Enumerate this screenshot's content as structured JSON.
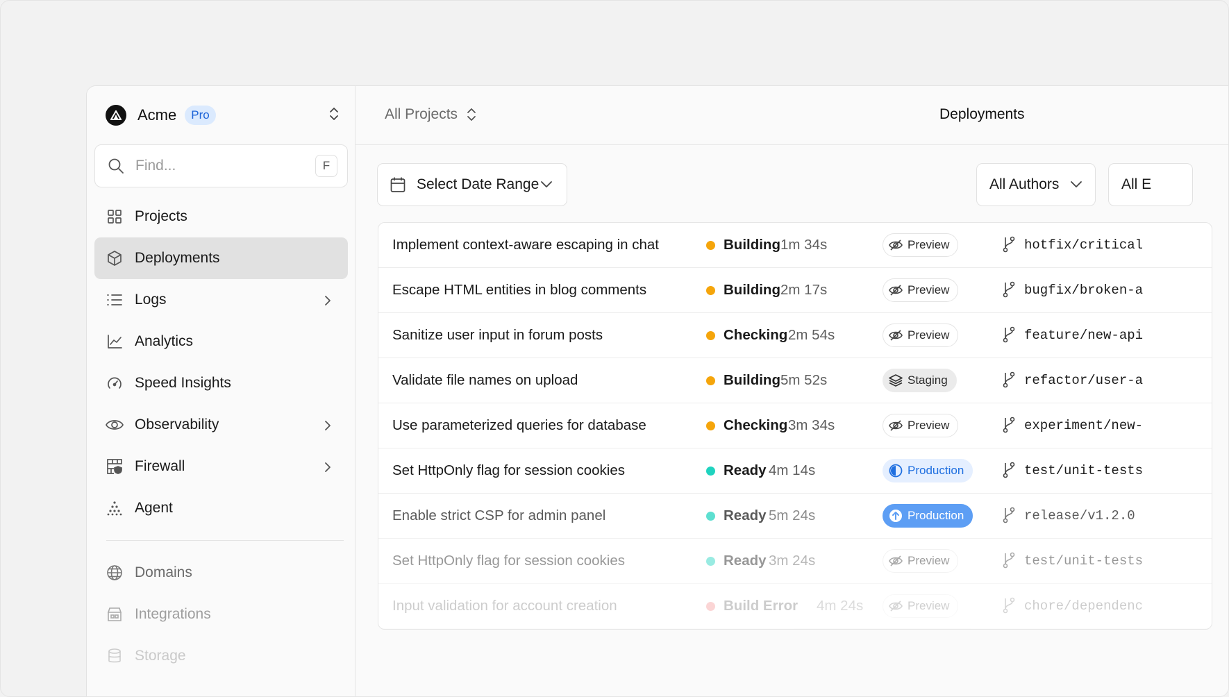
{
  "sidebar": {
    "team_name": "Acme",
    "plan_badge": "Pro",
    "search_placeholder": "Find...",
    "search_shortcut": "F",
    "items": [
      {
        "label": "Projects",
        "icon": "grid-icon"
      },
      {
        "label": "Deployments",
        "icon": "cube-icon",
        "active": true
      },
      {
        "label": "Logs",
        "icon": "list-icon",
        "has_chevron": true
      },
      {
        "label": "Analytics",
        "icon": "line-chart-icon"
      },
      {
        "label": "Speed Insights",
        "icon": "gauge-icon"
      },
      {
        "label": "Observability",
        "icon": "eye-icon",
        "has_chevron": true
      },
      {
        "label": "Firewall",
        "icon": "firewall-icon",
        "has_chevron": true
      },
      {
        "label": "Agent",
        "icon": "sparkle-dots-icon"
      }
    ],
    "secondary_items": [
      {
        "label": "Domains",
        "icon": "globe-icon"
      },
      {
        "label": "Integrations",
        "icon": "integrations-icon"
      },
      {
        "label": "Storage",
        "icon": "database-icon"
      }
    ]
  },
  "header": {
    "project_selector": "All Projects",
    "title": "Deployments"
  },
  "filters": {
    "date_range": "Select Date Range",
    "authors": "All Authors",
    "environments_partial": "All E"
  },
  "deployments": [
    {
      "message": "Implement context-aware escaping in chat",
      "status": "Building",
      "duration": "1m 34s",
      "environment": "Preview",
      "branch": "hotfix/critical",
      "status_color": "#f5a50b"
    },
    {
      "message": "Escape HTML entities in blog comments",
      "status": "Building",
      "duration": "2m 17s",
      "environment": "Preview",
      "branch": "bugfix/broken-a",
      "status_color": "#f5a50b"
    },
    {
      "message": "Sanitize user input in forum posts",
      "status": "Checking",
      "duration": "2m 54s",
      "environment": "Preview",
      "branch": "feature/new-api",
      "status_color": "#f5a50b"
    },
    {
      "message": "Validate file names on upload",
      "status": "Building",
      "duration": "5m 52s",
      "environment": "Staging",
      "branch": "refactor/user-a",
      "status_color": "#f5a50b"
    },
    {
      "message": "Use parameterized queries for database",
      "status": "Checking",
      "duration": "3m 34s",
      "environment": "Preview",
      "branch": "experiment/new-",
      "status_color": "#f5a50b"
    },
    {
      "message": "Set HttpOnly flag for session cookies",
      "status": "Ready",
      "duration": "4m 14s",
      "environment": "Production",
      "branch": "test/unit-tests",
      "status_color": "#1fd3bf"
    },
    {
      "message": "Enable strict CSP for admin panel",
      "status": "Ready",
      "duration": "5m 24s",
      "environment": "Production",
      "branch": "release/v1.2.0",
      "status_color": "#1fd3bf"
    },
    {
      "message": "Set HttpOnly flag for session cookies",
      "status": "Ready",
      "duration": "3m 24s",
      "environment": "Preview",
      "branch": "test/unit-tests",
      "status_color": "#1fd3bf"
    },
    {
      "message": "Input validation for account creation",
      "status": "Build Error",
      "duration": "4m 24s",
      "environment": "Preview",
      "branch": "chore/dependenc",
      "status_color": "#ef4444"
    }
  ],
  "colors": {
    "accent": "#1f7af0",
    "building": "#f5a50b",
    "ready": "#1fd3bf",
    "error": "#ef4444"
  }
}
